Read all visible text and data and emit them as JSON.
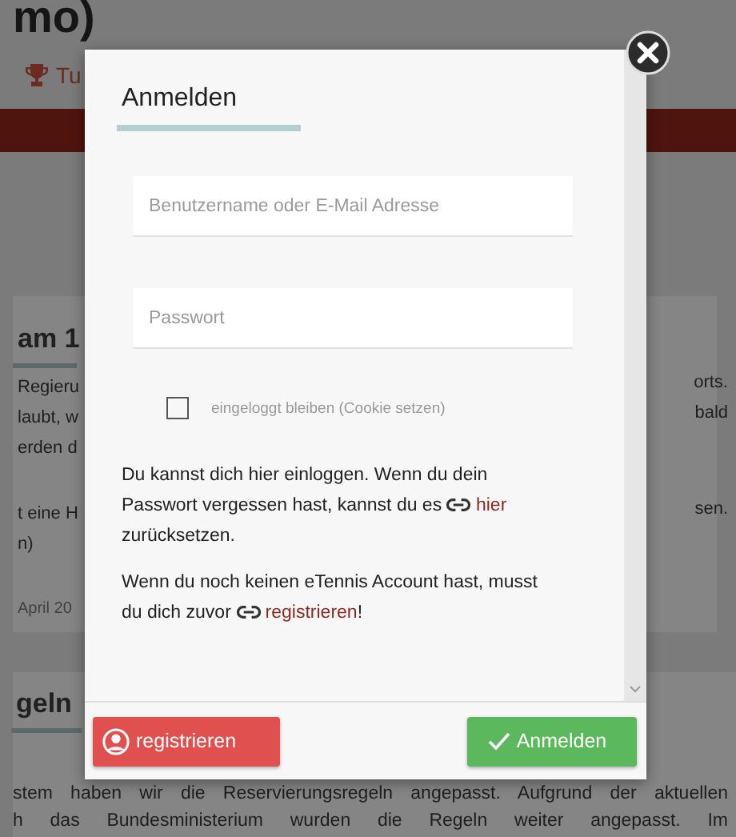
{
  "page": {
    "title_fragment": "mo)",
    "nav_fragment": "Tu",
    "news_card": {
      "title_fragment": "am 1",
      "left_lines": [
        "Regieru",
        "laubt, w",
        "erden d"
      ],
      "left_lines_2": [
        "t eine H",
        "n)"
      ],
      "date_fragment": "April 20",
      "right_lines": [
        "orts.",
        "bald"
      ],
      "right_lines_2": [
        "sen."
      ]
    },
    "rules_card": {
      "title_fragment": "geln",
      "lines": [
        "stem haben wir die Reservierungsregeln angepasst. Aufgrund der aktuellen",
        "h das Bundesministerium wurden die Regeln weiter angepasst. Im"
      ]
    }
  },
  "dialog": {
    "title": "Anmelden",
    "fields": [
      {
        "placeholder": "Benutzername oder E-Mail Adresse"
      },
      {
        "placeholder": "Passwort"
      }
    ],
    "remember": {
      "label": "eingeloggt bleiben (Cookie setzen)",
      "checked": false
    },
    "paragraphs": [
      {
        "before": "Du kannst dich hier einloggen. Wenn du dein Passwort vergessen hast, kannst du es",
        "link": "hier",
        "after": "zurücksetzen."
      },
      {
        "before": "Wenn du noch keinen eTennis Account hast, musst du dich zuvor",
        "link": "registrieren",
        "after": "!"
      }
    ],
    "buttons": [
      {
        "kind": "register",
        "label": "registrieren"
      },
      {
        "kind": "login",
        "label": "Anmelden"
      }
    ]
  }
}
